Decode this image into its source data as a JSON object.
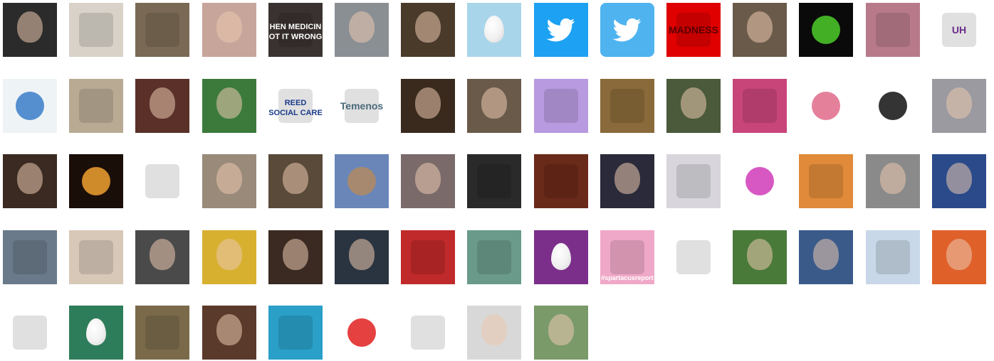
{
  "page": {
    "background": "#ffffff"
  },
  "avatars": [
    [
      {
        "bg": "#2b2b2b",
        "icon": "person-portrait-icon"
      },
      {
        "bg": "#d8d2c8",
        "icon": "heart-wreath-icon"
      },
      {
        "bg": "#7a6a55",
        "icon": "building-atrium-icon"
      },
      {
        "bg": "#c7a59b",
        "icon": "person-portrait-icon"
      },
      {
        "bg": "#3a3230",
        "icon": "text-image-icon",
        "text": [
          "HEN MEDICIN",
          "OT IT WRONG"
        ],
        "color": "#ffffff"
      },
      {
        "bg": "#8a8f94",
        "icon": "person-portrait-icon"
      },
      {
        "bg": "#4a3a2a",
        "icon": "person-portrait-icon"
      },
      {
        "bg": "#a9d5ea",
        "icon": "default-egg-icon"
      },
      {
        "bg": "#1da1f2",
        "icon": "twitter-bird-icon"
      },
      {
        "bg": "#4fb3ef",
        "icon": "twitter-bird-icon",
        "rounded": true
      },
      {
        "bg": "#e00000",
        "icon": "red-banner-icon",
        "text": [
          "MADNESS"
        ],
        "color": "#5a0000"
      },
      {
        "bg": "#6a5a4a",
        "icon": "person-portrait-icon"
      },
      {
        "bg": "#0a0a0a",
        "icon": "green-monster-icon",
        "accent": "#4ccd2a"
      },
      {
        "bg": "#b87a8a",
        "icon": "sunset-sky-icon"
      },
      {
        "bg": "#ffffff",
        "icon": "university-logo-icon",
        "text": [
          "UH"
        ],
        "color": "#6a2d8a"
      }
    ],
    [
      {
        "bg": "#eef3f6",
        "icon": "people-logo-icon",
        "accent": "#3a7dc8"
      },
      {
        "bg": "#b9aa94",
        "icon": "sand-drawing-icon"
      },
      {
        "bg": "#5a3028",
        "icon": "person-portrait-icon"
      },
      {
        "bg": "#3c7a3c",
        "icon": "person-portrait-icon"
      },
      {
        "bg": "#ffffff",
        "icon": "reed-logo-icon",
        "text": [
          "REED",
          "SOCIAL CARE"
        ],
        "color": "#1a3a8a"
      },
      {
        "bg": "#ffffff",
        "icon": "temenos-logo-icon",
        "text": [
          "Temenos"
        ],
        "color": "#4a6a7a"
      },
      {
        "bg": "#3a2a1e",
        "icon": "person-portrait-icon"
      },
      {
        "bg": "#6a5a4a",
        "icon": "person-portrait-icon"
      },
      {
        "bg": "#b89ae0",
        "icon": "board-game-icon"
      },
      {
        "bg": "#8a6a3a",
        "icon": "eyes-closeup-icon"
      },
      {
        "bg": "#4a5a3a",
        "icon": "person-portrait-icon"
      },
      {
        "bg": "#c8457a",
        "icon": "pink-map-icon"
      },
      {
        "bg": "#ffffff",
        "icon": "dragonfly-icon",
        "accent": "#e06a8a"
      },
      {
        "bg": "#ffffff",
        "icon": "star-logo-icon",
        "accent": "#111111"
      },
      {
        "bg": "#9a9aa0",
        "icon": "person-portrait-icon"
      }
    ],
    [
      {
        "bg": "#3a2a22",
        "icon": "person-portrait-icon"
      },
      {
        "bg": "#1a0e08",
        "icon": "candles-icon",
        "accent": "#f0a030"
      },
      {
        "bg": "#ffffff",
        "icon": "sheep-drawing-icon"
      },
      {
        "bg": "#9a8a7a",
        "icon": "person-portrait-icon"
      },
      {
        "bg": "#5a4a3a",
        "icon": "person-portrait-icon"
      },
      {
        "bg": "#6a86b8",
        "icon": "colosseum-icon",
        "accent": "#b08a60"
      },
      {
        "bg": "#7a6a6a",
        "icon": "person-portrait-icon"
      },
      {
        "bg": "#2a2a2a",
        "icon": "dark-texture-icon"
      },
      {
        "bg": "#6a2a1a",
        "icon": "painted-face-icon"
      },
      {
        "bg": "#2a2a3a",
        "icon": "person-portrait-icon"
      },
      {
        "bg": "#d8d6dc",
        "icon": "white-kitten-icon"
      },
      {
        "bg": "#ffffff",
        "icon": "pink-flower-icon",
        "accent": "#d03ab8"
      },
      {
        "bg": "#e08a3a",
        "icon": "ginger-cat-icon"
      },
      {
        "bg": "#8a8a8a",
        "icon": "person-portrait-icon"
      },
      {
        "bg": "#2a4a8a",
        "icon": "person-portrait-icon"
      }
    ],
    [
      {
        "bg": "#6a7a8a",
        "icon": "pebbles-icon"
      },
      {
        "bg": "#d8c8b8",
        "icon": "sketch-figure-icon"
      },
      {
        "bg": "#4a4a4a",
        "icon": "person-portrait-icon"
      },
      {
        "bg": "#d8b030",
        "icon": "person-portrait-icon"
      },
      {
        "bg": "#3a2a22",
        "icon": "person-portrait-icon"
      },
      {
        "bg": "#2a3440",
        "icon": "person-portrait-icon"
      },
      {
        "bg": "#c02a2a",
        "icon": "webpage-collage-icon"
      },
      {
        "bg": "#6a9a8a",
        "icon": "photo-collage-icon"
      },
      {
        "bg": "#7b2f8a",
        "icon": "default-egg-icon"
      },
      {
        "bg": "#f0a8c8",
        "icon": "clown-drawing-icon",
        "text": [
          "#spartacusreport"
        ],
        "color": "#ffffff"
      },
      {
        "bg": "#ffffff",
        "icon": "cartoon-drawing-icon"
      },
      {
        "bg": "#4a7a3a",
        "icon": "person-portrait-icon"
      },
      {
        "bg": "#3a5a8a",
        "icon": "person-portrait-icon"
      },
      {
        "bg": "#c8d8e8",
        "icon": "mountain-drawing-icon"
      },
      {
        "bg": "#e0602a",
        "icon": "person-portrait-icon"
      }
    ],
    [
      {
        "bg": "#ffffff",
        "icon": "cartoon-face-icon"
      },
      {
        "bg": "#2e7d5a",
        "icon": "default-egg-icon"
      },
      {
        "bg": "#7a6a4a",
        "icon": "pink-rose-icon"
      },
      {
        "bg": "#5a3a2a",
        "icon": "person-portrait-icon"
      },
      {
        "bg": "#2aa0c8",
        "icon": "stilt-hut-icon"
      },
      {
        "bg": "#ffffff",
        "icon": "red-pixels-icon",
        "accent": "#e02020"
      },
      {
        "bg": "#ffffff",
        "icon": "comic-strip-icon"
      },
      {
        "bg": "#d8d8d8",
        "icon": "person-portrait-icon"
      },
      {
        "bg": "#7a9a6a",
        "icon": "person-portrait-icon"
      }
    ]
  ]
}
